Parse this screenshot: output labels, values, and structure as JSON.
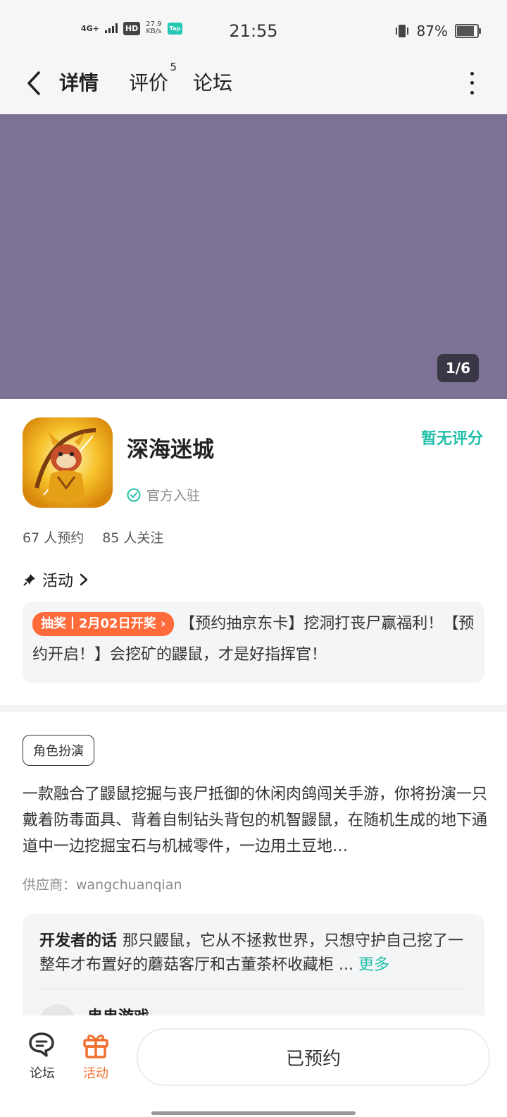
{
  "status_bar": {
    "network": "4G+",
    "hd": "HD",
    "speed_value": "27.9",
    "speed_unit": "KB/s",
    "app_badge": "Tap",
    "time": "21:55",
    "battery": "87%",
    "battery_level": 0.87
  },
  "nav": {
    "tabs": [
      {
        "label": "详情",
        "active": true
      },
      {
        "label": "评价",
        "badge": "5"
      },
      {
        "label": "论坛"
      }
    ]
  },
  "banner": {
    "color": "#7d7296",
    "pager": "1/6"
  },
  "game": {
    "title": "深海迷城",
    "official": "官方入驻",
    "rating": "暂无评分",
    "reservations": "67 人预约",
    "followers": "85 人关注"
  },
  "activity": {
    "heading": "活动",
    "tag": "抽奖丨2月02日开奖",
    "text": "【预约抽京东卡】挖洞打丧尸赢福利！【预约开启！】会挖矿的鼹鼠，才是好指挥官！"
  },
  "details": {
    "genre": "角色扮演",
    "description": "一款融合了鼹鼠挖掘与丧尸抵御的休闲肉鸽闯关手游，你将扮演一只戴着防毒面具、背着自制钻头背包的机智鼹鼠，在随机生成的地下通道中一边挖掘宝石与机械零件，一边用土豆地…",
    "supplier": "供应商：wangchuanqian"
  },
  "developer": {
    "label": "开发者的话",
    "text": "那只鼹鼠，它从不拯救世界，只想守护自己挖了一整年才布置好的蘑菇客厅和古董茶杯收藏柜 ... ",
    "more": "更多",
    "name": "串串游戏"
  },
  "bottom_bar": {
    "forum": "论坛",
    "activity": "活动",
    "reserved": "已预约",
    "accent": "#f0702e"
  }
}
